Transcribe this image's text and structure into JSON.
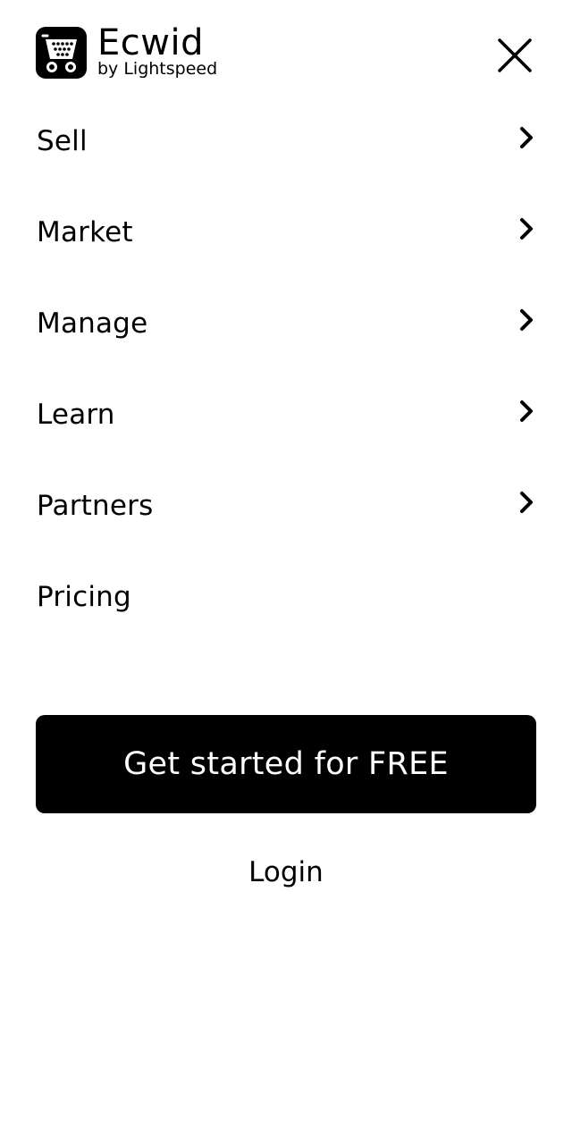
{
  "brand": {
    "name": "Ecwid",
    "tagline": "by Lightspeed",
    "icon": "shopping-cart-logo-icon",
    "color": "#000000"
  },
  "header": {
    "close_icon": "close-icon"
  },
  "nav": {
    "items": [
      {
        "label": "Sell",
        "has_submenu": true
      },
      {
        "label": "Market",
        "has_submenu": true
      },
      {
        "label": "Manage",
        "has_submenu": true
      },
      {
        "label": "Learn",
        "has_submenu": true
      },
      {
        "label": "Partners",
        "has_submenu": true
      },
      {
        "label": "Pricing",
        "has_submenu": false
      }
    ]
  },
  "cta": {
    "label": "Get started for FREE",
    "background": "#000000",
    "text_color": "#ffffff"
  },
  "login": {
    "label": "Login"
  }
}
